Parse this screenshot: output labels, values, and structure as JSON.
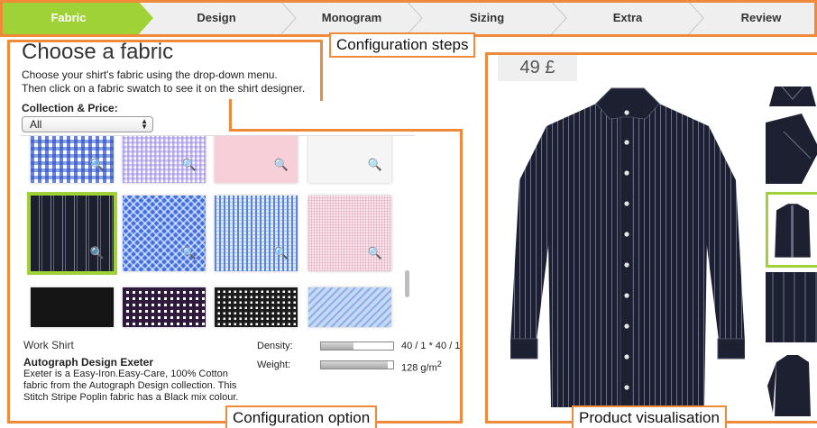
{
  "steps": [
    {
      "label": "Fabric"
    },
    {
      "label": "Design"
    },
    {
      "label": "Monogram"
    },
    {
      "label": "Sizing"
    },
    {
      "label": "Extra"
    },
    {
      "label": "Review"
    }
  ],
  "annotations": {
    "steps": "Configuration steps",
    "option": "Configuration option",
    "product": "Product visualisation"
  },
  "config": {
    "title": "Choose a fabric",
    "intro_line1": "Choose your shirt's fabric using the drop-down menu.",
    "intro_line2": "Then click on a fabric swatch to see it on the shirt designer.",
    "collection_label": "Collection & Price:",
    "collection_value": "All"
  },
  "details": {
    "category": "Work Shirt",
    "name": "Autograph Design Exeter",
    "description": "Exeter is a Easy-Iron.Easy-Care, 100% Cotton fabric from the Autograph Design collection. This Stitch Stripe Poplin fabric has a Black mix colour.",
    "density_label": "Density:",
    "density_value": "40 / 1 * 40 / 1",
    "density_level": 0.45,
    "weight_label": "Weight:",
    "weight_value": "128 g/m",
    "weight_unit_sup": "2",
    "weight_level": 0.93
  },
  "product": {
    "price": "49 £"
  },
  "icons": {
    "zoom": "magnifier-icon",
    "select": "up-down-arrows-icon"
  },
  "colors": {
    "accent_green": "#9fd236",
    "annotation_orange": "#ef8a3a"
  }
}
